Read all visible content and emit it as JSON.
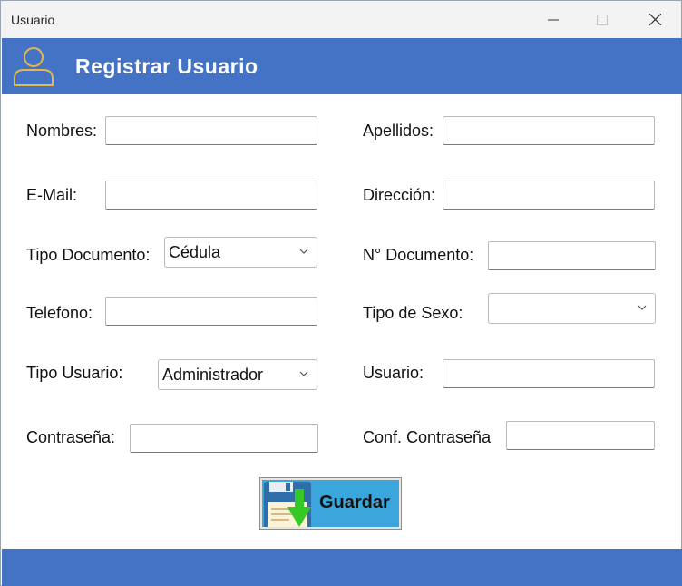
{
  "window": {
    "title": "Usuario"
  },
  "header": {
    "title": "Registrar Usuario"
  },
  "form": {
    "nombres": {
      "label": "Nombres:",
      "value": ""
    },
    "apellidos": {
      "label": "Apellidos:",
      "value": ""
    },
    "email": {
      "label": "E-Mail:",
      "value": ""
    },
    "direccion": {
      "label": "Dirección:",
      "value": ""
    },
    "tipo_documento": {
      "label": "Tipo Documento:",
      "selected": "Cédula"
    },
    "n_documento": {
      "label": "N° Documento:",
      "value": ""
    },
    "telefono": {
      "label": "Telefono:",
      "value": ""
    },
    "tipo_sexo": {
      "label": "Tipo de Sexo:",
      "selected": ""
    },
    "tipo_usuario": {
      "label": "Tipo Usuario:",
      "selected": "Administrador"
    },
    "usuario": {
      "label": "Usuario:",
      "value": ""
    },
    "contrasena": {
      "label": "Contraseña:",
      "value": ""
    },
    "conf_contrasena": {
      "label": "Conf. Contraseña",
      "value": ""
    }
  },
  "save_button": {
    "label": "Guardar",
    "icon": "floppy-disk-download-icon"
  },
  "colors": {
    "header": "#4472c4",
    "footer": "#4472c4",
    "button": "#3ba6dc",
    "arrow": "#34c924",
    "user_icon": "#e1b94f"
  }
}
